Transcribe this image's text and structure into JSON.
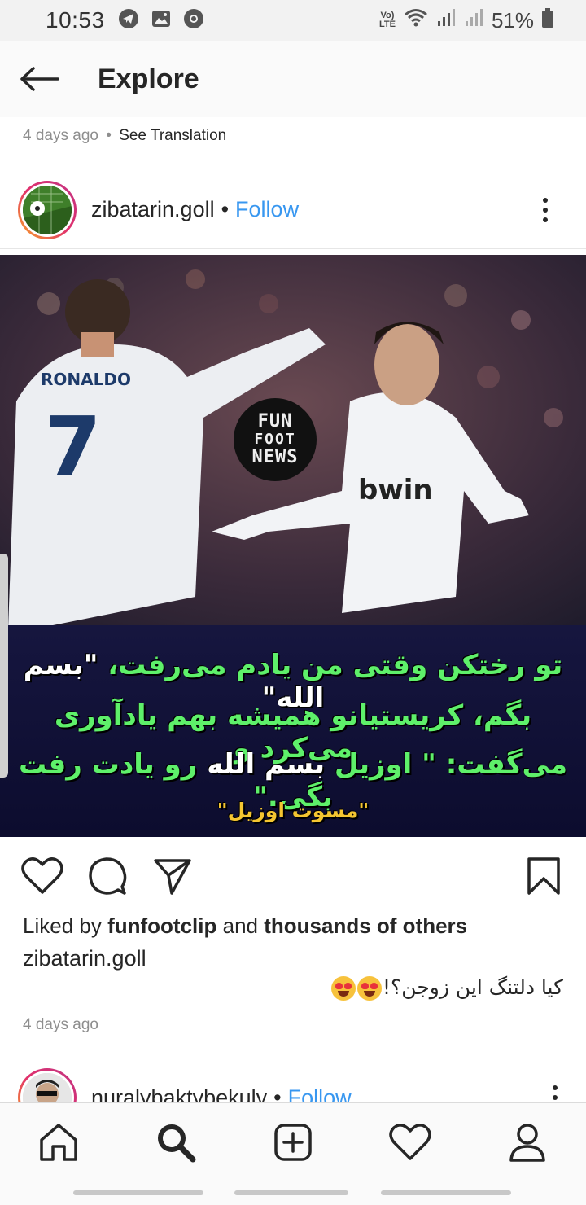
{
  "status_bar": {
    "time": "10:53",
    "volte_line1": "Vo)",
    "volte_line2": "LTE",
    "battery": "51%"
  },
  "header": {
    "title": "Explore"
  },
  "previous_post": {
    "time": "4 days ago",
    "separator": "•",
    "see_translation": "See Translation"
  },
  "post": {
    "username": "zibatarin.goll",
    "bullet": "•",
    "follow_label": "Follow",
    "image": {
      "logo_line1": "FUN",
      "logo_line2": "FOOT",
      "logo_line3": "NEWS",
      "jersey_name": "RONALDO",
      "jersey_number": "7",
      "sponsor": "bwin",
      "caption_line1_a": "تو رختکن وقتی من یادم می‌رفت،",
      "caption_line1_b": "\"بسم الله\"",
      "caption_line2": "بگم، کریستیانو همیشه بهم یادآوری می‌کرد و",
      "caption_line3_a": "می‌گفت: \" اوزیل",
      "caption_line3_b": "بسم الله",
      "caption_line3_c": "رو یادت رفت بگی.\"",
      "caption_line4": "\"مسوت اوزیل\""
    },
    "liked_by_prefix": "Liked by",
    "liked_by_user": "funfootclip",
    "liked_by_and": "and",
    "liked_by_others": "thousands of others",
    "caption_username": "zibatarin.goll",
    "caption_text": "کیا دلتنگ این زوجن؟!",
    "time": "4 days ago"
  },
  "next_post": {
    "username": "nuralybaktybekuly",
    "bullet": "•",
    "follow_label": "Follow"
  },
  "colors": {
    "link_blue": "#3897f0",
    "caption_green": "#5ef06a",
    "caption_yellow": "#f4c531"
  }
}
